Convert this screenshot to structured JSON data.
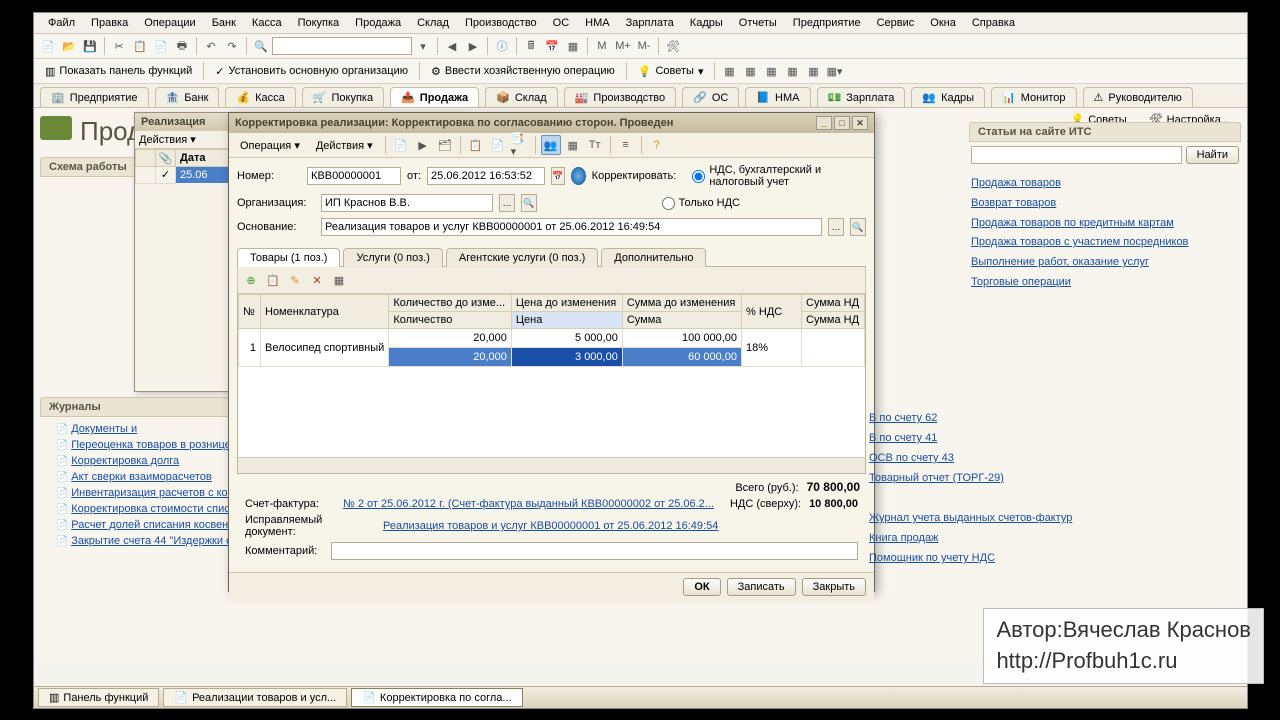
{
  "menu": [
    "Файл",
    "Правка",
    "Операции",
    "Банк",
    "Касса",
    "Покупка",
    "Продажа",
    "Склад",
    "Производство",
    "ОС",
    "НМА",
    "Зарплата",
    "Кадры",
    "Отчеты",
    "Предприятие",
    "Сервис",
    "Окна",
    "Справка"
  ],
  "toolbar2": {
    "show_panel": "Показать панель функций",
    "set_org": "Установить основную организацию",
    "enter_op": "Ввести хозяйственную операцию",
    "advice": "Советы"
  },
  "main_tabs": [
    "Предприятие",
    "Банк",
    "Касса",
    "Покупка",
    "Продажа",
    "Склад",
    "Производство",
    "ОС",
    "НМА",
    "Зарплата",
    "Кадры",
    "Монитор",
    "Руководителю"
  ],
  "main_tabs_active": 4,
  "top_right": {
    "advice": "Советы",
    "settings": "Настройка..."
  },
  "page_title": "Прод",
  "left": {
    "schema": "Схема работы",
    "account_icon": "Счет",
    "journals_header": "Журналы",
    "journals": [
      "Документы и",
      "Переоценка товаров в рознице",
      "Корректировка долга",
      "Акт сверки взаиморасчетов",
      "Инвентаризация расчетов с кон",
      "Корректировка стоимости спис",
      "Расчет долей списания косвен",
      "Закрытие счета 44 \"Издержки о"
    ]
  },
  "sub_window": {
    "title": "Реализация",
    "actions": "Действия",
    "date_col": "Дата",
    "date_val": "25.06"
  },
  "dialog": {
    "title": "Корректировка реализации: Корректировка по согласованию сторон. Проведен",
    "operation": "Операция",
    "actions": "Действия",
    "number_label": "Номер:",
    "number": "КВВ00000001",
    "from": "от:",
    "date": "25.06.2012 16:53:52",
    "correct_label": "Корректировать:",
    "radio1": "НДС, бухгалтерский и налоговый учет",
    "radio2": "Только НДС",
    "org_label": "Организация:",
    "org": "ИП Краснов В.В.",
    "base_label": "Основание:",
    "base": "Реализация товаров и услуг КВВ00000001 от 25.06.2012 16:49:54",
    "tabs": [
      "Товары (1 поз.)",
      "Услуги (0 поз.)",
      "Агентские услуги (0 поз.)",
      "Дополнительно"
    ],
    "columns_top": [
      "№",
      "Номенклатура",
      "Количество до изме...",
      "Цена до изменения",
      "Сумма до изменения",
      "% НДС",
      "Сумма НД"
    ],
    "columns_sub": [
      "",
      "",
      "Количество",
      "Цена",
      "Сумма",
      "",
      "Сумма НД"
    ],
    "row1": {
      "n": "1",
      "name": "Велосипед спортивный",
      "qty": "20,000",
      "price": "5 000,00",
      "sum": "100 000,00",
      "vat": "18%"
    },
    "row2": {
      "qty": "20,000",
      "price": "3 000,00",
      "sum": "60 000,00"
    },
    "total_label": "Всего (руб.):",
    "total": "70 800,00",
    "invoice_label": "Счет-фактура:",
    "invoice": "№ 2 от 25.06.2012 г. (Счет-фактура выданный КВВ00000002 от 25.06.2...",
    "vat_top_label": "НДС (сверху):",
    "vat_top": "10 800,00",
    "fix_doc_label": "Исправляемый документ:",
    "fix_doc": "Реализация товаров и услуг КВВ00000001 от 25.06.2012 16:49:54",
    "comment_label": "Комментарий:",
    "comment": "",
    "ok": "ОК",
    "write": "Записать",
    "close": "Закрыть"
  },
  "its": {
    "header": "Статьи на сайте ИТС",
    "find": "Найти",
    "links": [
      "Продажа товаров",
      "Возврат товаров",
      "Продажа товаров по кредитным картам",
      "Продажа товаров с участием посредников",
      "Выполнение работ, оказание услуг",
      "Торговые операции"
    ]
  },
  "side_links": [
    "В по счету 62",
    "В по счету 41",
    "ОСВ по счету 43",
    "Товарный отчет (ТОРГ-29)",
    "Журнал учета выданных счетов-фактур",
    "Книга продаж",
    "Помощник по учету НДС"
  ],
  "watermark": {
    "author": "Автор:Вячеслав Краснов",
    "url": "http://Profbuh1c.ru"
  },
  "taskbar": [
    "Панель функций",
    "Реализации товаров и усл...",
    "Корректировка по согла..."
  ]
}
